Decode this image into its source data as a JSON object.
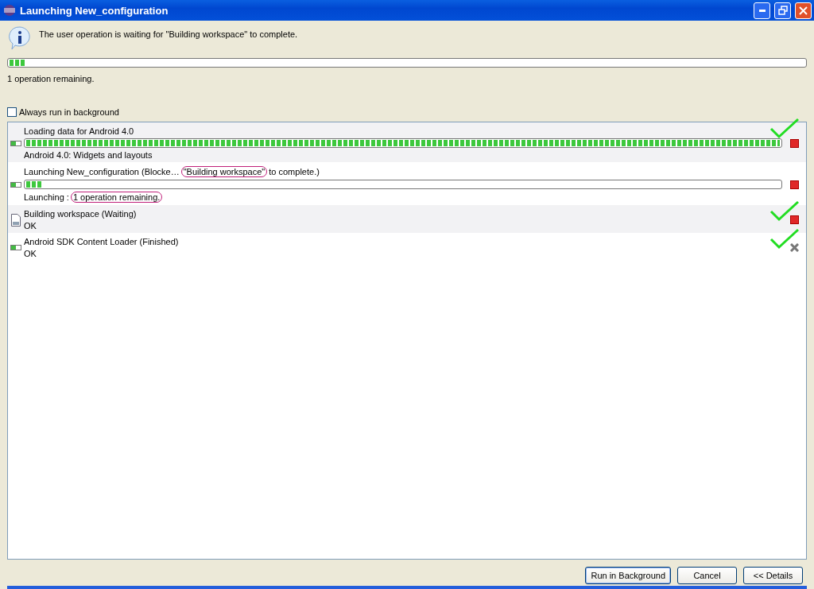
{
  "window": {
    "title": "Launching New_configuration"
  },
  "message": "The user operation is waiting for \"Building workspace\" to complete.",
  "overall_progress": {
    "level": 0.02
  },
  "remaining": "1 operation remaining.",
  "always_background": {
    "label": "Always run in background",
    "checked": false
  },
  "jobs": [
    {
      "kind": "progress",
      "title": [
        {
          "text": "Loading data for Android 4.0",
          "circled": false
        }
      ],
      "level": 1.0,
      "status": [
        {
          "text": "Android 4.0: Widgets and layouts",
          "circled": false
        }
      ],
      "finished": false,
      "checkmark": true
    },
    {
      "kind": "progress",
      "title": [
        {
          "text": "Launching New_configuration (Blocke…",
          "circled": false
        },
        {
          "text": "\"Building workspace\"",
          "circled": true
        },
        {
          "text": "to complete.)",
          "circled": false
        }
      ],
      "level": 0.02,
      "status": [
        {
          "text": "Launching :",
          "circled": false
        },
        {
          "text": "1 operation remaining.",
          "circled": true
        }
      ],
      "finished": false,
      "checkmark": false
    },
    {
      "kind": "file",
      "title": [
        {
          "text": "Building workspace (Waiting)",
          "circled": false
        }
      ],
      "status": [
        {
          "text": "OK",
          "circled": false
        }
      ],
      "finished": false,
      "checkmark": true
    },
    {
      "kind": "progress",
      "title": [
        {
          "text": "Android SDK Content Loader (Finished)",
          "circled": false
        }
      ],
      "status": [
        {
          "text": "OK",
          "circled": false
        }
      ],
      "finished": true,
      "checkmark": true
    }
  ],
  "buttons": [
    {
      "label": "Run in Background",
      "default": true
    },
    {
      "label": "Cancel",
      "default": false
    },
    {
      "label": "<< Details",
      "default": false
    }
  ]
}
